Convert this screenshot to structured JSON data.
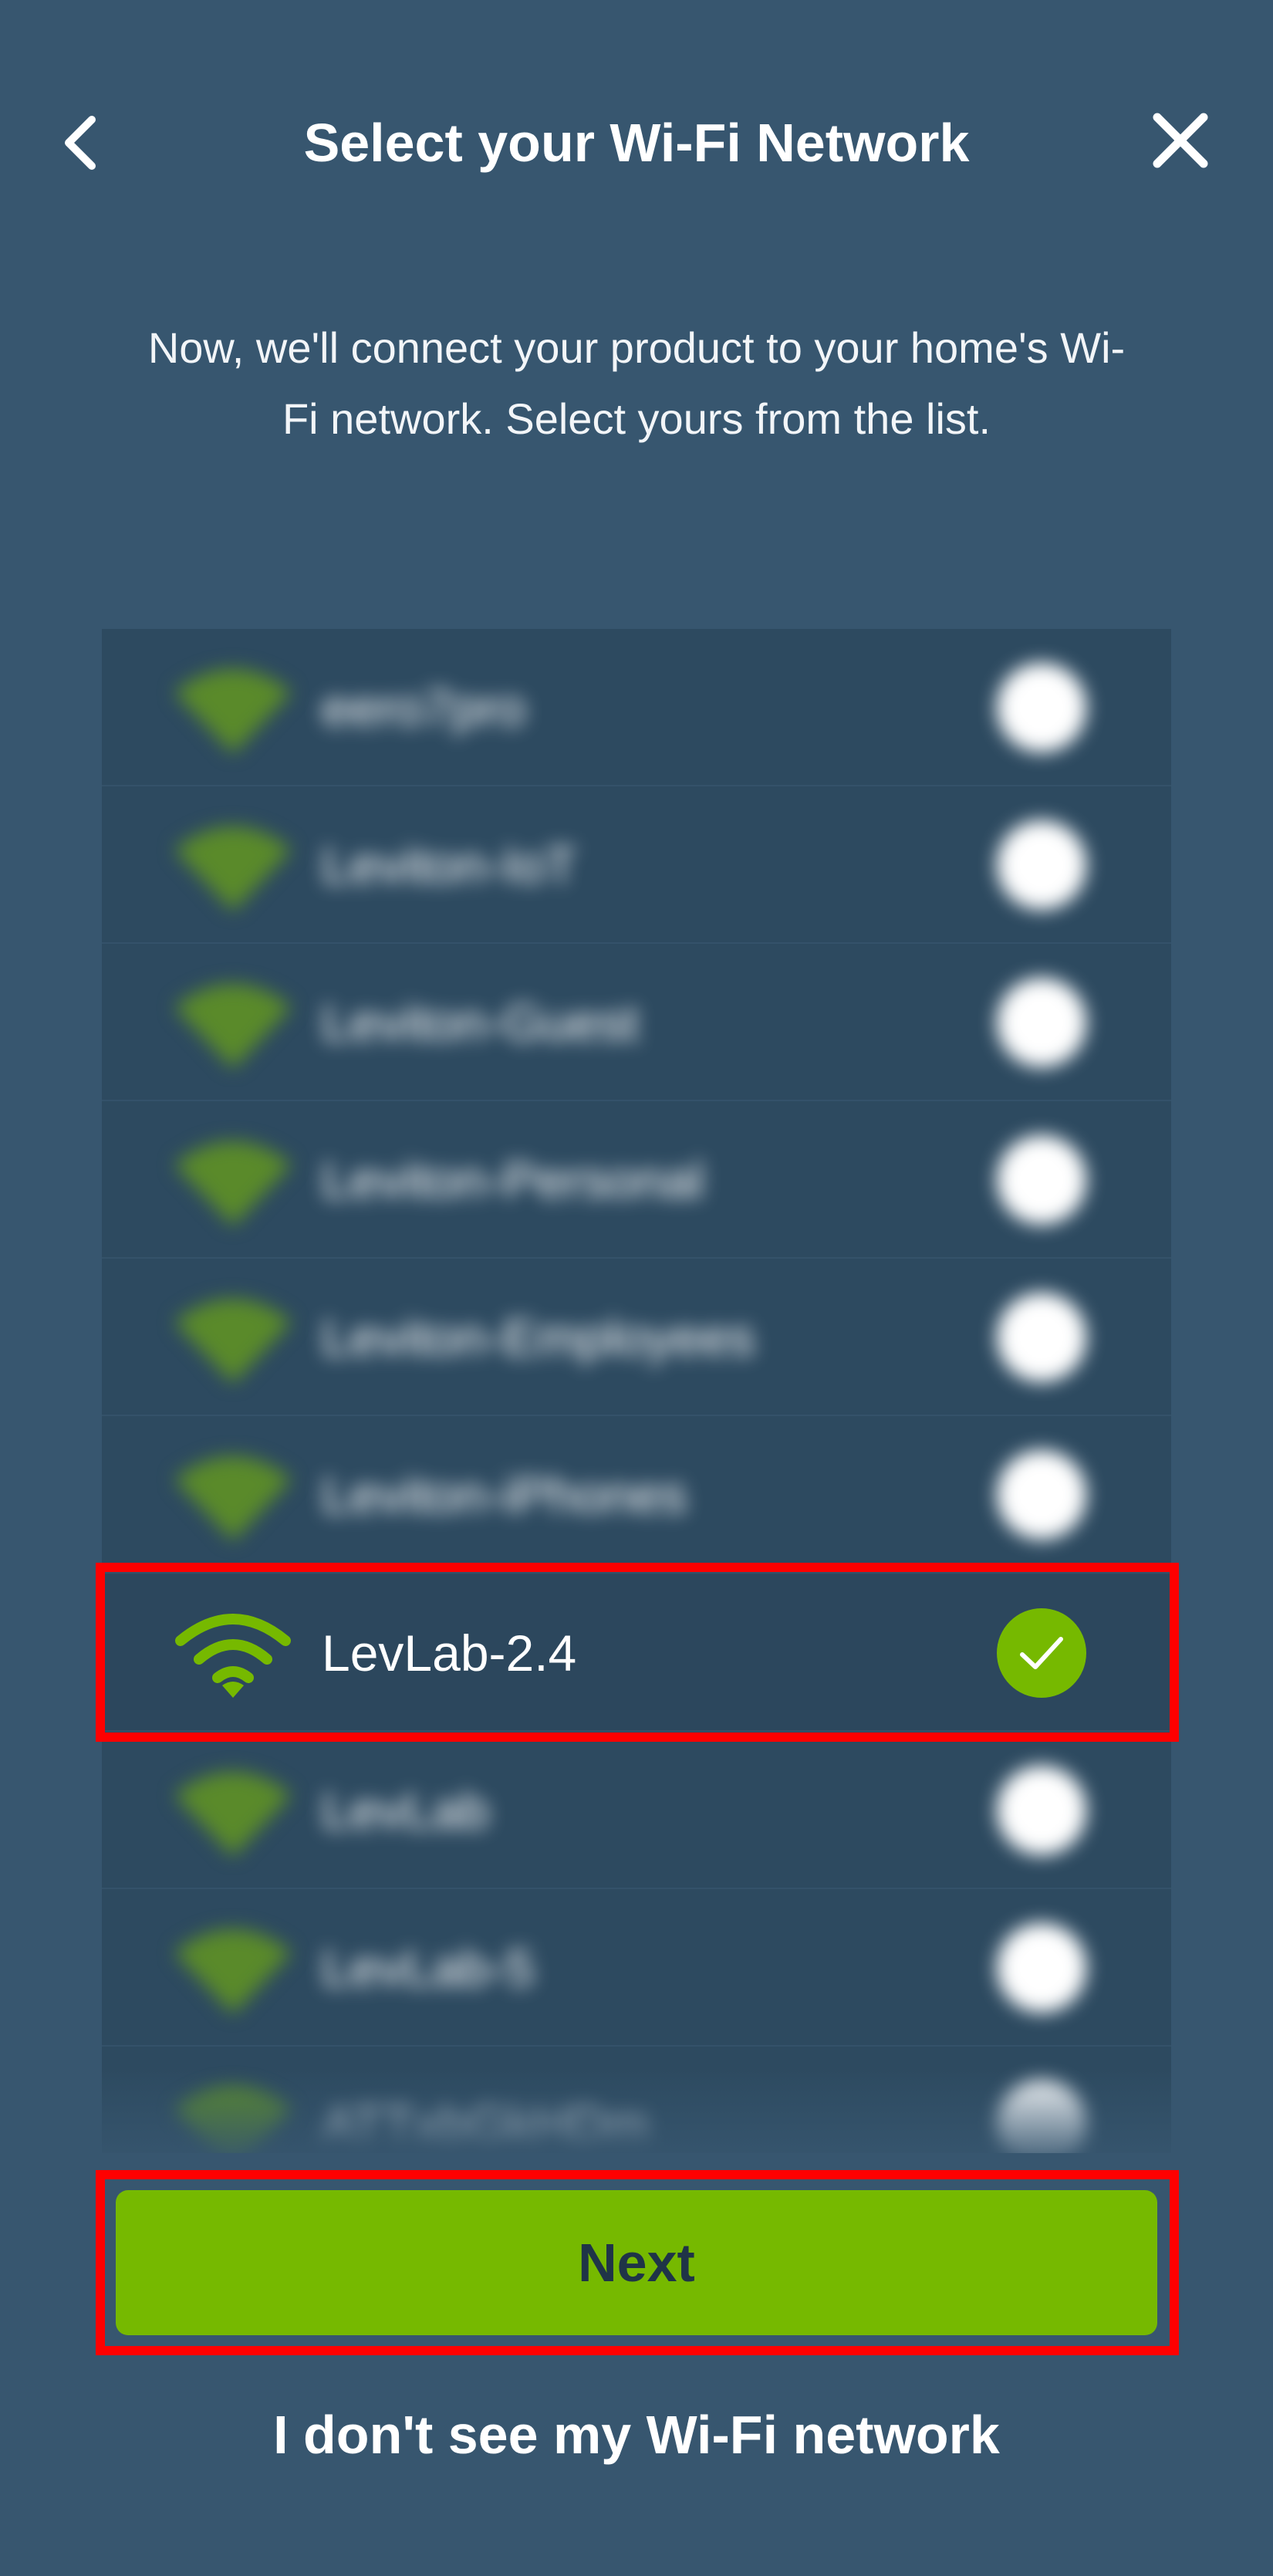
{
  "header": {
    "title": "Select your Wi-Fi Network",
    "back_icon": "chevron-left-icon",
    "close_icon": "close-icon"
  },
  "subtitle": "Now, we'll connect your product to your home's Wi-Fi network. Select yours from the list.",
  "networks": [
    {
      "name": "eero7pro",
      "selected": false
    },
    {
      "name": "Leviton-IoT",
      "selected": false
    },
    {
      "name": "Leviton-Guest",
      "selected": false
    },
    {
      "name": "Leviton-Personal",
      "selected": false
    },
    {
      "name": "Leviton-Employees",
      "selected": false
    },
    {
      "name": "Leviton-iPhones",
      "selected": false
    },
    {
      "name": "LevLab-2.4",
      "selected": true
    },
    {
      "name": "LevLab",
      "selected": false
    },
    {
      "name": "LevLab-5",
      "selected": false
    },
    {
      "name": "ATTxbGkHDm",
      "selected": false
    }
  ],
  "next_label": "Next",
  "help_link": "I don't see my Wi-Fi network",
  "colors": {
    "background": "#37566f",
    "list_background": "#2d4a60",
    "accent_green": "#76b900",
    "wifi_icon_blurred": "#5a8a2a",
    "highlight_red": "#ff0000"
  }
}
